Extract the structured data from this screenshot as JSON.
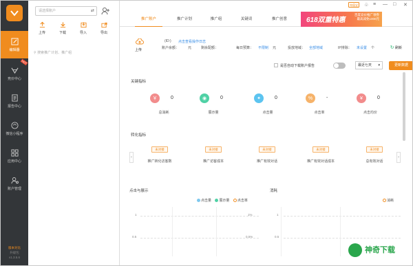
{
  "nav": {
    "items": [
      {
        "label": "编辑器",
        "icon": "edit-icon"
      },
      {
        "label": "竞价中心",
        "icon": "bid-icon",
        "badge": "HOT"
      },
      {
        "label": "报告中心",
        "icon": "report-icon"
      },
      {
        "label": "微信小程序",
        "icon": "miniprogram-icon"
      },
      {
        "label": "应用中心",
        "icon": "apps-icon"
      },
      {
        "label": "账户管理",
        "icon": "account-icon"
      }
    ],
    "footer_version": "版本对比",
    "footer_sub1": "升级包",
    "footer_sub2": "v1.3.5.6"
  },
  "accounts": {
    "search_placeholder": "请选择账户",
    "tools": [
      {
        "label": "上传",
        "icon": "upload-icon"
      },
      {
        "label": "下载",
        "icon": "download-icon"
      },
      {
        "label": "导入",
        "icon": "import-icon"
      },
      {
        "label": "导出",
        "icon": "export-icon"
      }
    ],
    "filter_placeholder": "搜索推广计划、推广组"
  },
  "tabs": [
    "推广账户",
    "推广计划",
    "推广组",
    "关键词",
    "推广创意"
  ],
  "banner": {
    "title": "618双重特惠",
    "line1": "百度竞价推广领券",
    "line2": "最高减免1000元"
  },
  "topbar": {
    "pay_label": "充值宝"
  },
  "info": {
    "upload_label": "上传",
    "id_label": "(ID:)",
    "log_link": "点击查看操作日志",
    "balance_label": "账户余额：",
    "balance_unit": "元",
    "recharge_label": "剩余配额：",
    "daily_budget_label": "每日预算：",
    "daily_budget_value": "不限制",
    "daily_budget_unit": "元",
    "region_label": "投放地域：",
    "region_value": "全部地域",
    "ip_label": "IP排除：",
    "ip_value": "未设置",
    "refresh_label": "刷新"
  },
  "filters": {
    "auto_download_label": "是否自动下载账户报告",
    "range_value": "最近七天",
    "update_button": "更新数据"
  },
  "key_metrics": {
    "title": "关键指标",
    "items": [
      {
        "label": "总消耗",
        "value": "0",
        "color": "#f28c8c",
        "icon": "￥"
      },
      {
        "label": "展示量",
        "value": "0",
        "color": "#4fd1a5",
        "icon": "◉"
      },
      {
        "label": "点击量",
        "value": "0",
        "color": "#5cc4f0",
        "icon": "✦"
      },
      {
        "label": "点击率",
        "value": "-",
        "color": "#f6b36a",
        "icon": "%"
      },
      {
        "label": "点击均价",
        "value": "0",
        "color": "#f28c8c",
        "icon": "¥"
      }
    ]
  },
  "conversion": {
    "title": "转化指标",
    "tag": "未对接",
    "items": [
      "推广转化访客数",
      "推广访客成本",
      "推广有效对话",
      "推广有效对话成本",
      "总有效对话"
    ]
  },
  "chart_clicks": {
    "title": "点击与展示",
    "legend": [
      {
        "name": "点击量",
        "color": "#7ec8ee",
        "style": "dot"
      },
      {
        "name": "展示量",
        "color": "#4fd1a5",
        "style": "dot"
      },
      {
        "name": "点击率",
        "color": "#f08c1e",
        "style": "ring"
      }
    ],
    "y_left": [
      "1",
      "0.5"
    ],
    "y_right": [
      "1%",
      "0.5%"
    ]
  },
  "chart_spend": {
    "title": "消耗",
    "legend": [
      {
        "name": "消耗",
        "color": "#f08c1e",
        "style": "ring"
      }
    ],
    "y_left": [
      "1",
      "0.5"
    ]
  },
  "watermark": {
    "text": "神奇下载"
  }
}
